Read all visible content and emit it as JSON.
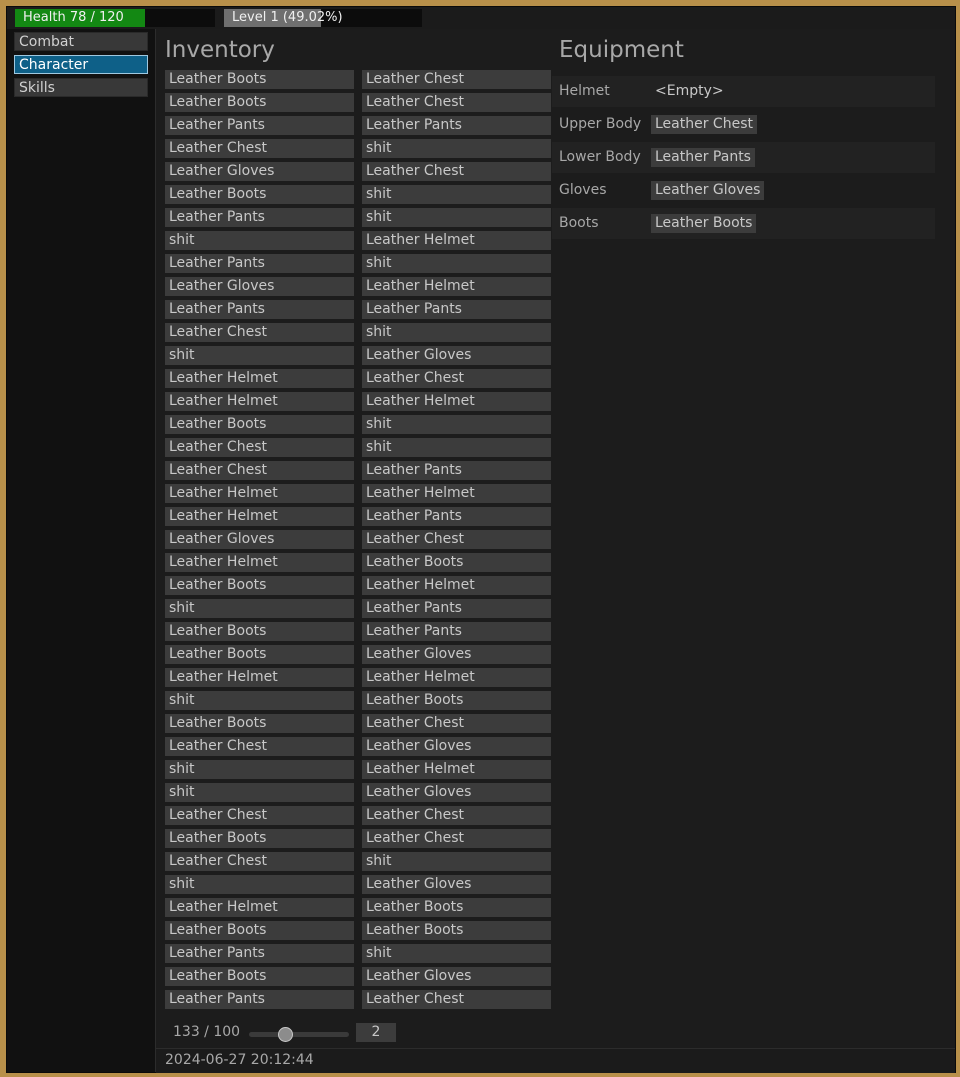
{
  "top_bar": {
    "health": {
      "text": "Health 78 / 120",
      "value": 78,
      "max": 120,
      "color": "#138813"
    },
    "level": {
      "text": "Level 1 (49.02%)",
      "progress": 0.4902,
      "color": "#6f6f6f"
    }
  },
  "sidebar": {
    "tabs": [
      {
        "label": "Combat",
        "active": false
      },
      {
        "label": "Character",
        "active": true
      },
      {
        "label": "Skills",
        "active": false
      }
    ]
  },
  "inventory": {
    "title": "Inventory",
    "column_left": [
      "Leather Boots",
      "Leather Boots",
      "Leather Pants",
      "Leather Chest",
      "Leather Gloves",
      "Leather Boots",
      "Leather Pants",
      "shit",
      "Leather Pants",
      "Leather Gloves",
      "Leather Pants",
      "Leather Chest",
      "shit",
      "Leather Helmet",
      "Leather Helmet",
      "Leather Boots",
      "Leather Chest",
      "Leather Chest",
      "Leather Helmet",
      "Leather Helmet",
      "Leather Gloves",
      "Leather Helmet",
      "Leather Boots",
      "shit",
      "Leather Boots",
      "Leather Boots",
      "Leather Helmet",
      "shit",
      "Leather Boots",
      "Leather Chest",
      "shit",
      "shit",
      "Leather Chest",
      "Leather Boots",
      "Leather Chest",
      "shit",
      "Leather Helmet",
      "Leather Boots",
      "Leather Pants",
      "Leather Boots",
      "Leather Pants"
    ],
    "column_right": [
      "Leather Chest",
      "Leather Chest",
      "Leather Pants",
      "shit",
      "Leather Chest",
      "shit",
      "shit",
      "Leather Helmet",
      "shit",
      "Leather Helmet",
      "Leather Pants",
      "shit",
      "Leather Gloves",
      "Leather Chest",
      "Leather Helmet",
      "shit",
      "shit",
      "Leather Pants",
      "Leather Helmet",
      "Leather Pants",
      "Leather Chest",
      "Leather Boots",
      "Leather Helmet",
      "Leather Pants",
      "Leather Pants",
      "Leather Gloves",
      "Leather Helmet",
      "Leather Boots",
      "Leather Chest",
      "Leather Gloves",
      "Leather Helmet",
      "Leather Gloves",
      "Leather Chest",
      "Leather Chest",
      "shit",
      "Leather Gloves",
      "Leather Boots",
      "Leather Boots",
      "shit",
      "Leather Gloves",
      "Leather Chest"
    ],
    "pager": {
      "count": "133 / 100",
      "page": "2",
      "slider_fraction": 0.36
    }
  },
  "equipment": {
    "title": "Equipment",
    "slots": [
      {
        "label": "Helmet",
        "value": "<Empty>",
        "empty": true
      },
      {
        "label": "Upper Body",
        "value": "Leather Chest",
        "empty": false
      },
      {
        "label": "Lower Body",
        "value": "Leather Pants",
        "empty": false
      },
      {
        "label": "Gloves",
        "value": "Leather Gloves",
        "empty": false
      },
      {
        "label": "Boots",
        "value": "Leather Boots",
        "empty": false
      }
    ]
  },
  "footer": {
    "timestamp": "2024-06-27 20:12:44"
  }
}
